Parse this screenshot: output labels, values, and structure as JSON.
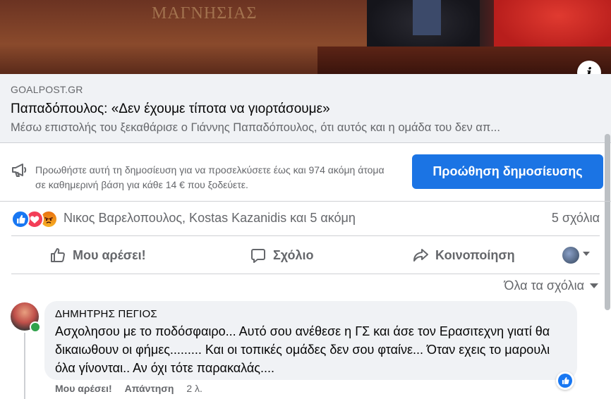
{
  "link_preview": {
    "image_sign_text": "ΜΑΓΝΗΣΙΑΣ",
    "domain": "GOALPOST.GR",
    "title": "Παπαδόπουλος: «Δεν έχουμε τίποτα να γιορτάσουμε»",
    "description": "Μέσω επιστολής του ξεκαθάρισε ο Γιάννης Παπαδόπουλος, ότι αυτός και η ομάδα του δεν απ...",
    "info_label": "i"
  },
  "promotion": {
    "text": "Προωθήστε αυτή τη δημοσίευση για να προσελκύσετε έως και 974 ακόμη άτομα σε καθημερινή βάση για κάθε 14 € που ξοδεύετε.",
    "button_label": "Προώθηση δημοσίευσης",
    "button_color": "#1b74e4"
  },
  "reactions": {
    "types": [
      "like",
      "love",
      "angry"
    ],
    "names": "Νικος Βαρελοπουλος, Kostas Kazanidis και 5 ακόμη",
    "comments_count": "5 σχόλια"
  },
  "actions": {
    "like": "Μου αρέσει!",
    "comment": "Σχόλιο",
    "share": "Κοινοποίηση"
  },
  "comments_filter": "Όλα τα σχόλια",
  "comment": {
    "author": "ΔΗΜΗΤΡΗΣ ΠΕΓΙΟΣ",
    "text": "Ασχολησου με το ποδόσφαιρο... Αυτό σου ανέθεσε η ΓΣ και άσε τον Ερασιτεχνη γιατί θα δικαιωθουν οι φήμες......... Και οι τοπικές ομάδες δεν σου φταίνε... Όταν εχεις το μαρουλι όλα γίνονται.. Αν όχι τότε παρακαλάς....",
    "like_label": "Μου αρέσει!",
    "reply_label": "Απάντηση",
    "time": "2 λ.",
    "reaction": "like"
  }
}
